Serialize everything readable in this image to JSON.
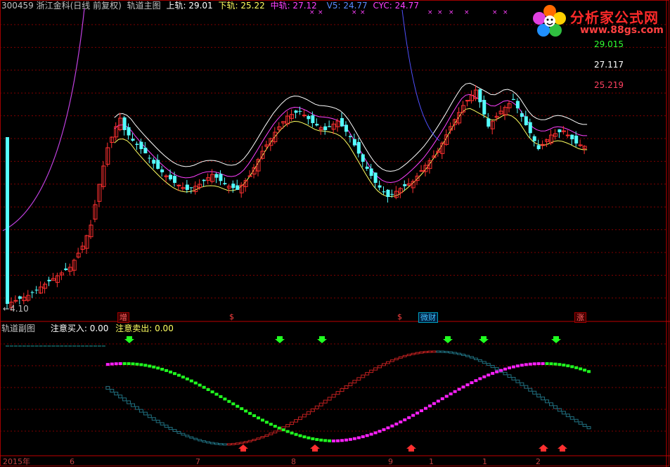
{
  "main_header": {
    "stock": "300459 浙江金科(日线 前复权)",
    "indicator": "轨道主图",
    "upper_label": "上轨: 29.01",
    "lower_label": "下轨: 25.22",
    "mid_label": "中轨: 27.12",
    "v5_label": "V5: 24.77",
    "cyc_label": "CYC: 24.77"
  },
  "logo": {
    "title": "分析家公式网",
    "url": "www.88gs.com"
  },
  "price_labels": {
    "upper": "29.015",
    "mid": "27.117",
    "lower": "25.219",
    "min": "4.10"
  },
  "event_tags": [
    "增",
    "$",
    "$",
    "微财",
    "涨"
  ],
  "sub_header": {
    "indicator": "轨道副图",
    "buy_label": "注意买入: 0.00",
    "sell_label": "注意卖出: 0.00"
  },
  "x_axis": {
    "labels": [
      "2015年",
      "6",
      "7",
      "8",
      "9",
      "1",
      "1",
      "2"
    ]
  },
  "colors": {
    "up": "#ff3030",
    "down": "#54ffff",
    "upper_band": "#ffffff",
    "mid_band": "#ff40ff",
    "lower_band": "#ffff60",
    "cyc_line": "#5050ff",
    "green_signal": "#20ff20",
    "magenta_signal": "#ff20ff",
    "grid": "#800000"
  },
  "chart_data": {
    "type": "candlestick",
    "title": "300459 浙江金科 日线 轨道主图",
    "series": [
      {
        "name": "上轨",
        "last": 29.01
      },
      {
        "name": "中轨",
        "last": 27.12
      },
      {
        "name": "下轨",
        "last": 25.22
      },
      {
        "name": "V5",
        "last": 24.77
      },
      {
        "name": "CYC",
        "last": 24.77
      }
    ],
    "sub_chart": {
      "title": "轨道副图",
      "series": [
        {
          "name": "注意买入",
          "last": 0.0
        },
        {
          "name": "注意卖出",
          "last": 0.0
        }
      ]
    }
  }
}
